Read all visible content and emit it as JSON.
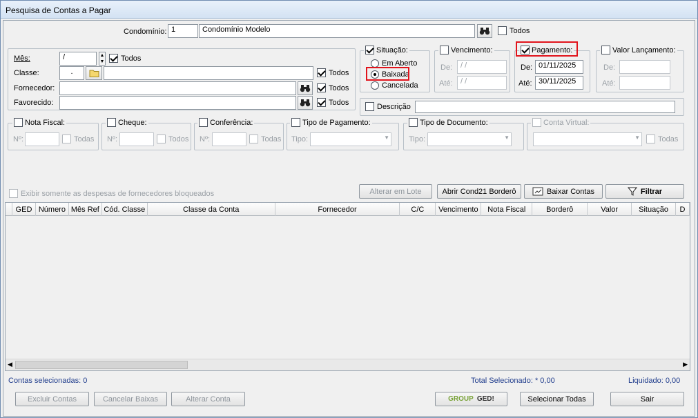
{
  "window": {
    "title": "Pesquisa de Contas a Pagar"
  },
  "top": {
    "condominio_label": "Condomínio:",
    "condominio_code": "1",
    "condominio_name": "Condomínio Modelo",
    "todos_label": "Todos",
    "todos_checked": false
  },
  "filters": {
    "mes_label": "Mês:",
    "mes_value": "/",
    "mes_todos_label": "Todos",
    "classe_label": "Classe:",
    "classe_value": ".",
    "fornecedor_label": "Fornecedor:",
    "favorecido_label": "Favorecido:",
    "todos_label": "Todos"
  },
  "situacao": {
    "label": "Situação:",
    "options": [
      "Em Aberto",
      "Baixada",
      "Cancelada"
    ],
    "selected": "Baixada"
  },
  "vencimento": {
    "label": "Vencimento:",
    "de_label": "De:",
    "ate_label": "Até:",
    "de_value": "/ /",
    "ate_value": "/ /"
  },
  "pagamento": {
    "label": "Pagamento:",
    "de_label": "De:",
    "ate_label": "Até:",
    "de_value": "01/11/2025",
    "ate_value": "30/11/2025"
  },
  "valor_lancamento": {
    "label": "Valor Lançamento:",
    "de_label": "De:",
    "ate_label": "Até:"
  },
  "descricao": {
    "label": "Descrição"
  },
  "nota_fiscal": {
    "label": "Nota Fiscal:",
    "num_label": "Nº:",
    "todas_label": "Todas"
  },
  "cheque": {
    "label": "Cheque:",
    "num_label": "Nº:",
    "todas_label": "Todos"
  },
  "conferencia": {
    "label": "Conferência:",
    "num_label": "Nº:",
    "todas_label": "Todas"
  },
  "tipo_pagamento": {
    "label": "Tipo de Pagamento:",
    "tipo_label": "Tipo:"
  },
  "tipo_documento": {
    "label": "Tipo de Documento:",
    "tipo_label": "Tipo:"
  },
  "conta_virtual": {
    "label": "Conta Virtual:",
    "todas_label": "Todas"
  },
  "bloqueados_label": "Exibir somente as despesas de fornecedores bloqueados",
  "actions": {
    "alterar_lote": "Alterar em Lote",
    "abrir_bordero": "Abrir Cond21 Borderô",
    "baixar_contas": "Baixar Contas",
    "filtrar": "Filtrar"
  },
  "table": {
    "columns": [
      "GED",
      "Número",
      "Mês Ref",
      "Cód. Classe",
      "Classe da Conta",
      "Fornecedor",
      "C/C",
      "Vencimento",
      "Nota Fiscal",
      "Borderô",
      "Valor",
      "Situação",
      "D"
    ]
  },
  "status": {
    "selecionadas": "Contas selecionadas: 0",
    "total": "Total Selecionado: * 0,00",
    "liquidado": "Liquidado: 0,00"
  },
  "bottom": {
    "excluir": "Excluir Contas",
    "cancelar": "Cancelar Baixas",
    "alterar": "Alterar Conta",
    "ged_group": "GROUP",
    "ged": "GED!",
    "selecionar": "Selecionar Todas",
    "sair": "Sair"
  },
  "colors": {
    "highlight": "#e1131b",
    "footer_text": "#1f3c8c",
    "titlebar": "#d3e2f3"
  }
}
